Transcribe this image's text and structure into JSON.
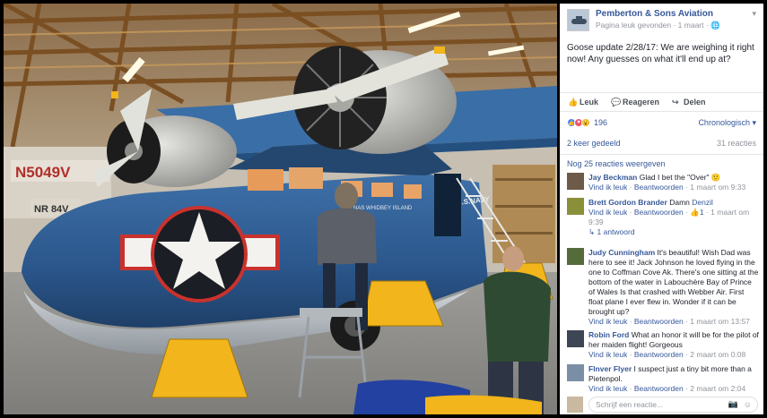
{
  "photo": {
    "registration": "N5049V",
    "nose_marking": "NR 84V",
    "plane_name": "NAS WHIDBEY ISLAND",
    "fuselage_marking": "U.S.NAVY",
    "colors": {
      "navy_blue": "#2f5d93",
      "yellow": "#f2b51b",
      "red": "#c9322d"
    }
  },
  "post": {
    "page_name": "Pemberton & Sons Aviation",
    "page_sub": "Pagina leuk gevonden · 1 maart · ",
    "globe_icon": "globe-icon",
    "text": "Goose update 2/28/17: We are weighing it right now! Any guesses on what it'll end up at?",
    "actions": {
      "like": "Leuk",
      "comment": "Reageren",
      "share": "Delen"
    },
    "reaction_count": "196",
    "sort": "Chronologisch ▾",
    "shares": "2 keer gedeeld",
    "reactions_total": "31 reacties",
    "more_replies": "Nog 25 reacties weergeven"
  },
  "comments": [
    {
      "name": "Jay Beckman",
      "text": " Glad I bet the \"Over\" 🙂",
      "like": "Vind ik leuk",
      "reply": "Beantwoorden",
      "time": "1 maart om 9:33"
    },
    {
      "name": "Brett Gordon Brander",
      "text_before": " Damn ",
      "link": "Denzil",
      "like": "Vind ik leuk",
      "reply": "Beantwoorden",
      "likes": "1",
      "time": "1 maart om 9:39",
      "replies": "1 antwoord"
    },
    {
      "name": "Judy Cunningham",
      "text": " It's beautiful! Wish Dad was here to see it! Jack Johnson he loved flying in the one to Coffman Cove Ak. There's one sitting at the bottom of the water in Labouchère Bay of Prince of Wales Is that crashed with Webber Air. First float plane I ever flew in. Wonder if it can be brought up?",
      "like": "Vind ik leuk",
      "reply": "Beantwoorden",
      "time": "1 maart om 13:57"
    },
    {
      "name": "Robin Ford",
      "text": " What an honor it will be for the pilot of her maiden flight! Gorgeous",
      "like": "Vind ik leuk",
      "reply": "Beantwoorden",
      "time": "2 maart om 0:08"
    },
    {
      "name": "Flnver Flyer",
      "text": " I suspect just a tiny bit more than a Pietenpol.",
      "like": "Vind ik leuk",
      "reply": "Beantwoorden",
      "time": "2 maart om 2:04"
    }
  ],
  "composer": {
    "placeholder": "Schrijf een reactie..."
  }
}
